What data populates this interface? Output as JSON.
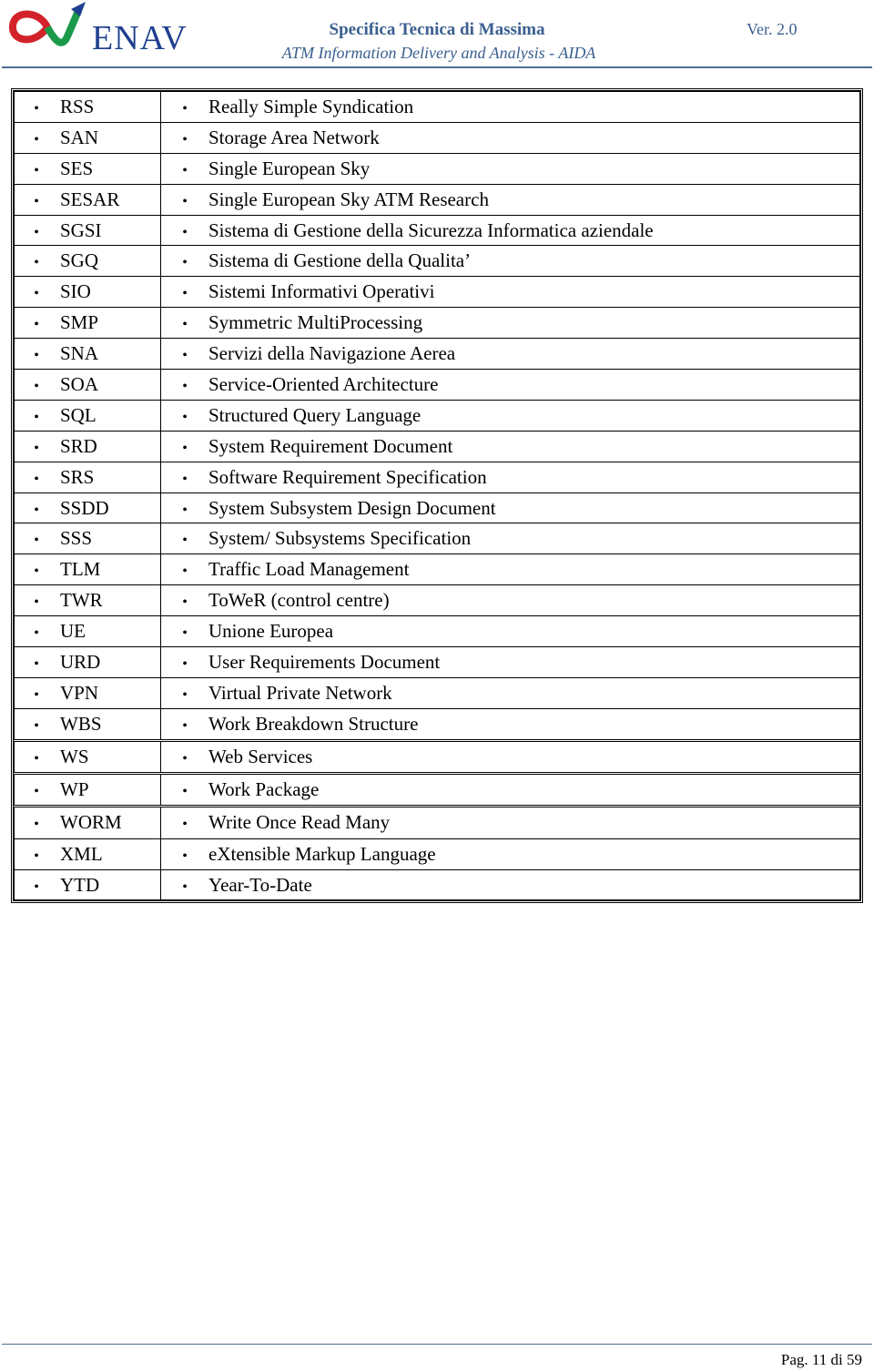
{
  "header": {
    "logo_text": "ENAV",
    "title": "Specifica Tecnica di Massima",
    "subtitle": "ATM Information Delivery and Analysis - AIDA",
    "version": "Ver. 2.0"
  },
  "rows": [
    {
      "abbr": "RSS",
      "desc": "Really Simple Syndication"
    },
    {
      "abbr": "SAN",
      "desc": "Storage Area Network"
    },
    {
      "abbr": "SES",
      "desc": "Single European Sky"
    },
    {
      "abbr": "SESAR",
      "desc": "Single European Sky ATM Research"
    },
    {
      "abbr": "SGSI",
      "desc": "Sistema di Gestione della Sicurezza Informatica aziendale"
    },
    {
      "abbr": "SGQ",
      "desc": "Sistema di Gestione della Qualita’"
    },
    {
      "abbr": "SIO",
      "desc": "Sistemi Informativi Operativi"
    },
    {
      "abbr": "SMP",
      "desc": "Symmetric MultiProcessing"
    },
    {
      "abbr": "SNA",
      "desc": "Servizi della Navigazione Aerea"
    },
    {
      "abbr": "SOA",
      "desc": "Service-Oriented Architecture"
    },
    {
      "abbr": "SQL",
      "desc": "Structured Query Language"
    },
    {
      "abbr": "SRD",
      "desc": "System Requirement Document"
    },
    {
      "abbr": "SRS",
      "desc": "Software Requirement Specification"
    },
    {
      "abbr": "SSDD",
      "desc": "System Subsystem Design Document"
    },
    {
      "abbr": "SSS",
      "desc": "System/ Subsystems Specification"
    },
    {
      "abbr": "TLM",
      "desc": "Traffic Load Management"
    },
    {
      "abbr": "TWR",
      "desc": "ToWeR (control centre)"
    },
    {
      "abbr": "UE",
      "desc": "Unione Europea"
    },
    {
      "abbr": "URD",
      "desc": "User Requirements Document"
    },
    {
      "abbr": "VPN",
      "desc": "Virtual Private Network"
    },
    {
      "abbr": "WBS",
      "desc": "Work Breakdown Structure"
    },
    {
      "abbr": "WS",
      "desc": "Web Services"
    },
    {
      "abbr": "WP",
      "desc": "Work Package"
    },
    {
      "abbr": "WORM",
      "desc": "Write Once Read Many"
    },
    {
      "abbr": "XML",
      "desc": "eXtensible Markup Language"
    },
    {
      "abbr": "YTD",
      "desc": "Year-To-Date"
    }
  ],
  "bullet": "•",
  "footer": {
    "page": "Pag. 11 di 59"
  }
}
